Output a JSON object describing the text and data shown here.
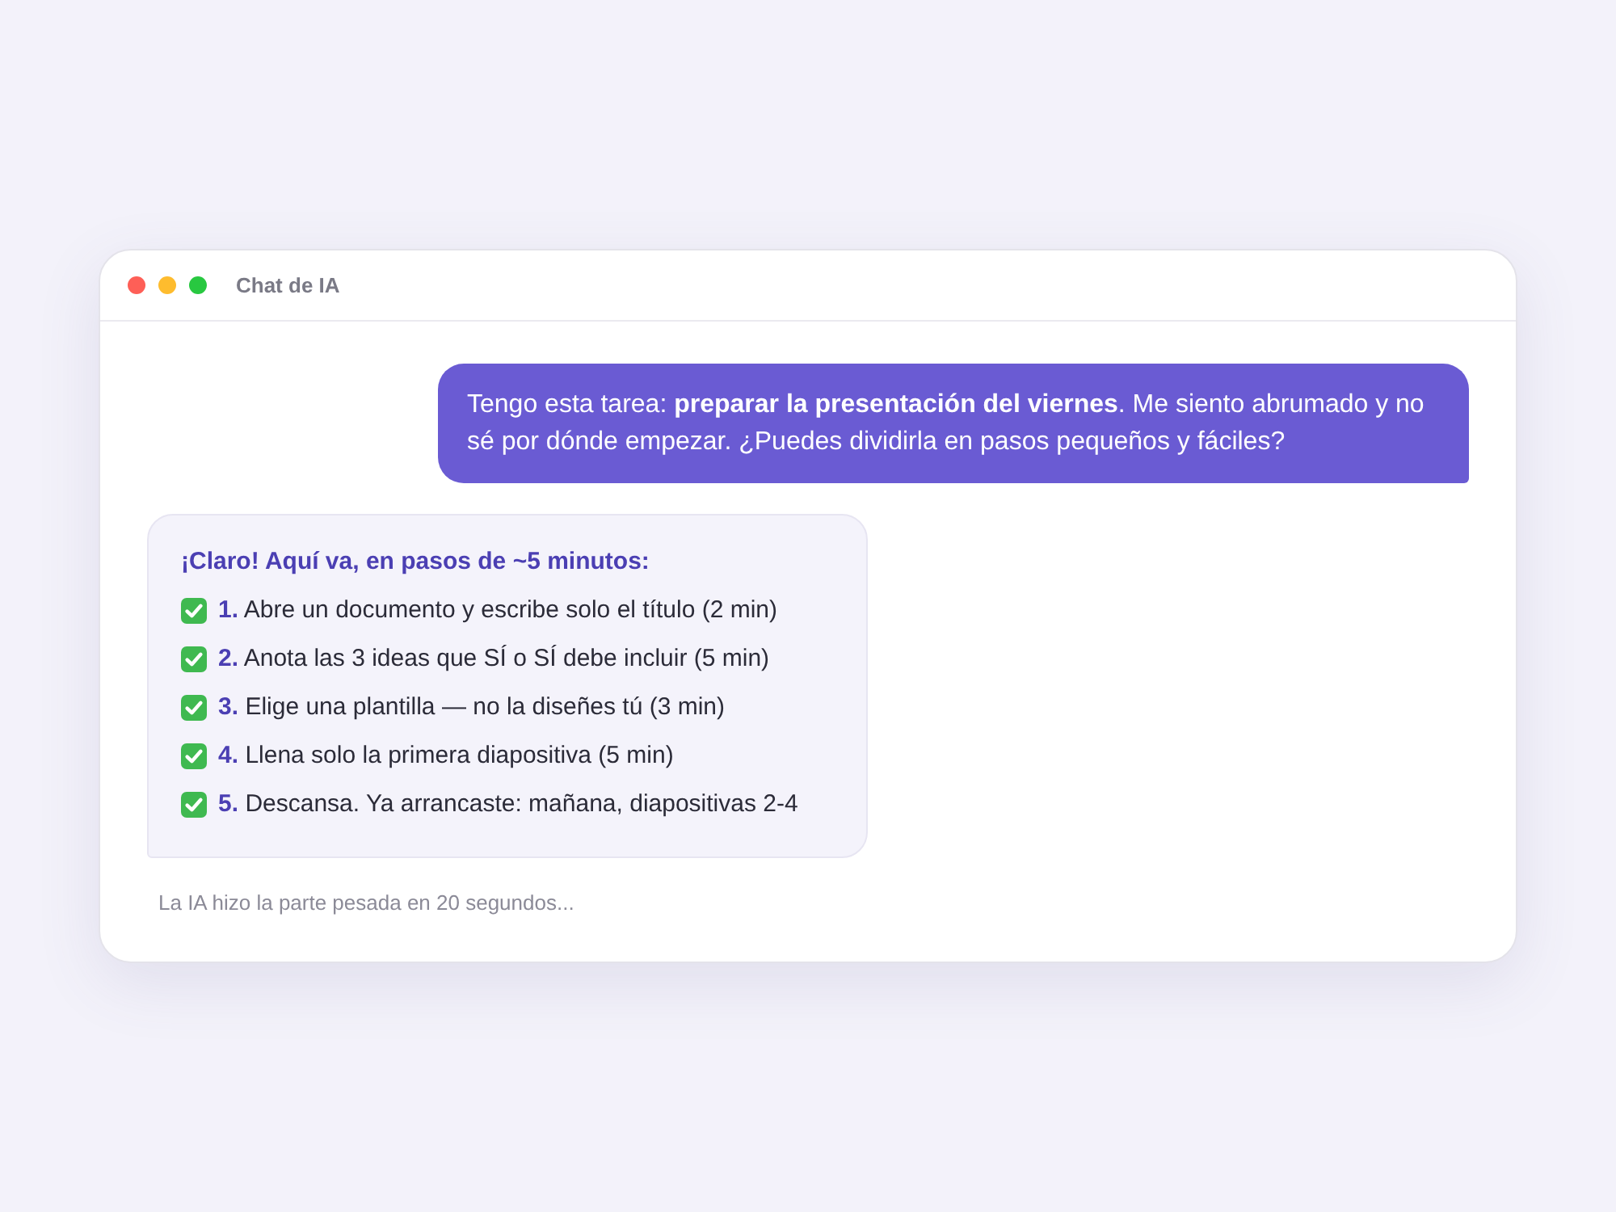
{
  "window": {
    "title": "Chat de IA"
  },
  "messages": [
    {
      "kind": "user",
      "text": "Tengo esta tarea: **preparar la presentación del viernes**. Me siento abrumado y no sé por dónde empezar. ¿Puedes dividirla en pasos pequeños y fáciles?"
    },
    {
      "kind": "assistant",
      "heading": "¡Claro! Aquí va, en pasos de ~5 minutos:",
      "steps": [
        {
          "number": "1.",
          "text": "Abre un documento y escribe solo el título (2 min)",
          "checked": true
        },
        {
          "number": "2.",
          "text": "Anota las 3 ideas que SÍ o SÍ debe incluir (5 min)",
          "checked": true
        },
        {
          "number": "3.",
          "text": "Elige una plantilla — no la diseñes tú (3 min)",
          "checked": true
        },
        {
          "number": "4.",
          "text": "Llena solo la primera diapositiva (5 min)",
          "checked": true
        },
        {
          "number": "5.",
          "text": "Descansa. Ya arrancaste: mañana, diapositivas 2-4",
          "checked": true
        }
      ]
    }
  ],
  "footer": "La IA hizo la parte pesada en 20 segundos..."
}
